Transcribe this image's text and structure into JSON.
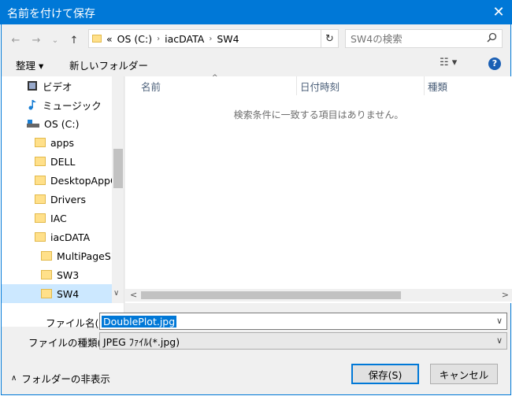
{
  "window": {
    "title": "名前を付けて保存",
    "close_glyph": "✕"
  },
  "nav": {
    "back": "←",
    "forward": "→",
    "recent": "⌄",
    "up": "↑"
  },
  "address": {
    "prefix": "«",
    "crumbs": [
      "OS (C:)",
      "iacDATA",
      "SW4"
    ],
    "sep": "›",
    "refresh": "↻"
  },
  "search": {
    "placeholder": "SW4の検索",
    "icon": "magnifier"
  },
  "toolbar": {
    "organize": "整理 ▾",
    "new_folder": "新しいフォルダー",
    "view": "☷ ▾",
    "help": "?"
  },
  "tree": {
    "items": [
      {
        "label": "ビデオ",
        "icon": "video-icon"
      },
      {
        "label": "ミュージック",
        "icon": "music-icon"
      },
      {
        "label": "OS (C:)",
        "icon": "drive-icon"
      },
      {
        "label": "apps",
        "icon": "folder-icon"
      },
      {
        "label": "DELL",
        "icon": "folder-icon"
      },
      {
        "label": "DesktopAppC",
        "icon": "folder-icon"
      },
      {
        "label": "Drivers",
        "icon": "folder-icon"
      },
      {
        "label": "IAC",
        "icon": "folder-icon"
      },
      {
        "label": "iacDATA",
        "icon": "folder-icon"
      },
      {
        "label": "MultiPageSD",
        "icon": "folder-icon"
      },
      {
        "label": "SW3",
        "icon": "folder-icon"
      },
      {
        "label": "SW4",
        "icon": "folder-icon",
        "selected": true
      }
    ]
  },
  "list": {
    "columns": [
      "名前",
      "日付時刻",
      "種類"
    ],
    "empty_message": "検索条件に一致する項目はありません。"
  },
  "form": {
    "filename_label": "ファイル名(N):",
    "filename_value": "DoublePlot.jpg",
    "filetype_label": "ファイルの種類(T):",
    "filetype_value": "JPEG ﾌｧｲﾙ(*.jpg)"
  },
  "footer": {
    "hide_folders": "フォルダーの非表示",
    "save": "保存(S)",
    "cancel": "キャンセル"
  },
  "colors": {
    "accent": "#0078d7",
    "selection": "#cce8ff"
  }
}
